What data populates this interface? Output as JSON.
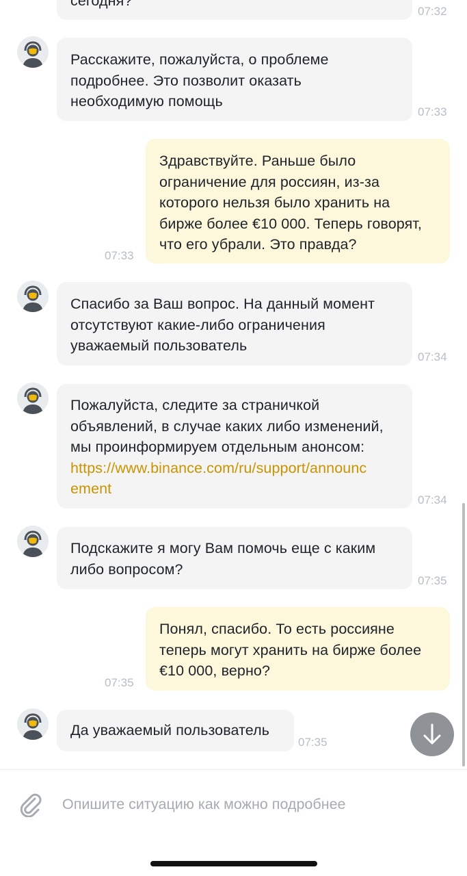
{
  "messages": [
    {
      "from": "support",
      "lines": [
        "сегодня?"
      ],
      "time": "07:32"
    },
    {
      "from": "support",
      "lines": [
        "Расскажите, пожалуйста, о проблеме",
        "подробнее. Это позволит оказать",
        "необходимую помощь"
      ],
      "time": "07:33"
    },
    {
      "from": "user",
      "lines": [
        "Здравствуйте. Раньше было",
        "ограничение для россиян, из-за",
        "которого нельзя было хранить на",
        "бирже более €10 000. Теперь говорят,",
        "что его убрали. Это правда?"
      ],
      "time": "07:33"
    },
    {
      "from": "support",
      "lines": [
        "Спасибо за Ваш вопрос. На данный момент",
        "отсутствуют какие-либо ограничения",
        "уважаемый пользователь"
      ],
      "time": "07:34"
    },
    {
      "from": "support",
      "lines": [
        "Пожалуйста, следите за страничкой",
        "объявлений, в случае каких либо изменений,",
        "мы проинформируем отдельным анонсом:"
      ],
      "link_lines": [
        "https://www.binance.com/ru/support/announc",
        "ement"
      ],
      "time": "07:34"
    },
    {
      "from": "support",
      "lines": [
        "Подскажите я могу Вам помочь еще с каким",
        "либо вопросом?"
      ],
      "time": "07:35"
    },
    {
      "from": "user",
      "lines": [
        "Понял, спасибо. То есть россияне",
        "теперь могут хранить на бирже более",
        "€10 000, верно?"
      ],
      "time": "07:35"
    },
    {
      "from": "support",
      "lines": [
        "Да уважаемый пользователь"
      ],
      "time": "07:35"
    }
  ],
  "composer": {
    "placeholder": "Опишите ситуацию как можно подробнее"
  },
  "icons": {
    "attach": "paperclip-icon",
    "scroll": "arrow-down-icon",
    "avatar": "support-agent-avatar-icon"
  },
  "colors": {
    "incoming_bubble": "#f4f4f5",
    "outgoing_bubble": "#fdf7dc",
    "link": "#c99400",
    "timestamp": "#b7bdc6"
  }
}
